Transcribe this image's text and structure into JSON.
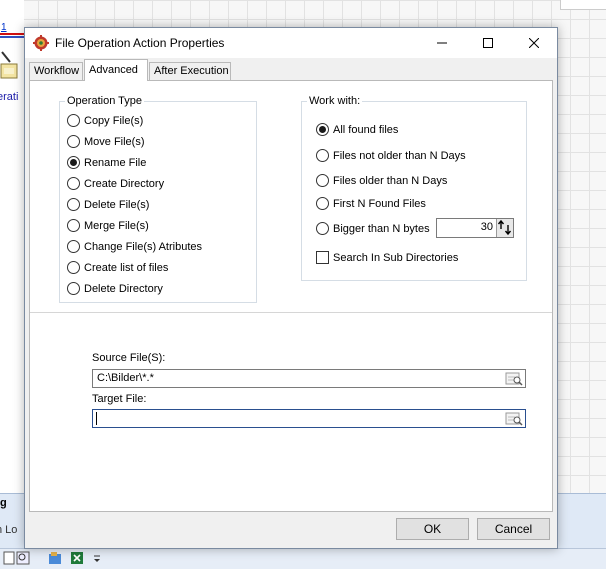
{
  "background": {
    "tab_number": "1",
    "tab_label": "erati",
    "panel_title": "g",
    "panel_tab": "n Lo"
  },
  "dialog": {
    "title": "File Operation Action Properties",
    "tabs": [
      {
        "label": "Workflow",
        "active": false
      },
      {
        "label": "Advanced",
        "active": true
      },
      {
        "label": "After Execution",
        "active": false
      }
    ],
    "operation_type": {
      "legend": "Operation Type",
      "options": [
        {
          "label": "Copy File(s)",
          "checked": false
        },
        {
          "label": "Move File(s)",
          "checked": false
        },
        {
          "label": "Rename File",
          "checked": true
        },
        {
          "label": "Create Directory",
          "checked": false
        },
        {
          "label": "Delete File(s)",
          "checked": false
        },
        {
          "label": "Merge File(s)",
          "checked": false
        },
        {
          "label": "Change File(s) Atributes",
          "checked": false
        },
        {
          "label": "Create list of files",
          "checked": false
        },
        {
          "label": "Delete Directory",
          "checked": false
        }
      ]
    },
    "work_with": {
      "legend": "Work with:",
      "options": [
        {
          "label": "All found files",
          "checked": true
        },
        {
          "label": "Files not older than N Days",
          "checked": false
        },
        {
          "label": "Files older than N Days",
          "checked": false
        },
        {
          "label": "First N Found Files",
          "checked": false
        },
        {
          "label": "Bigger than N bytes",
          "checked": false
        }
      ],
      "bytes_value": "30",
      "search_subdirs_label": "Search In Sub Directories",
      "search_subdirs_checked": false
    },
    "source": {
      "label": "Source File(S):",
      "value": "C:\\Bilder\\*.*"
    },
    "target": {
      "label": "Target File:",
      "value": ""
    },
    "buttons": {
      "ok": "OK",
      "cancel": "Cancel"
    }
  }
}
